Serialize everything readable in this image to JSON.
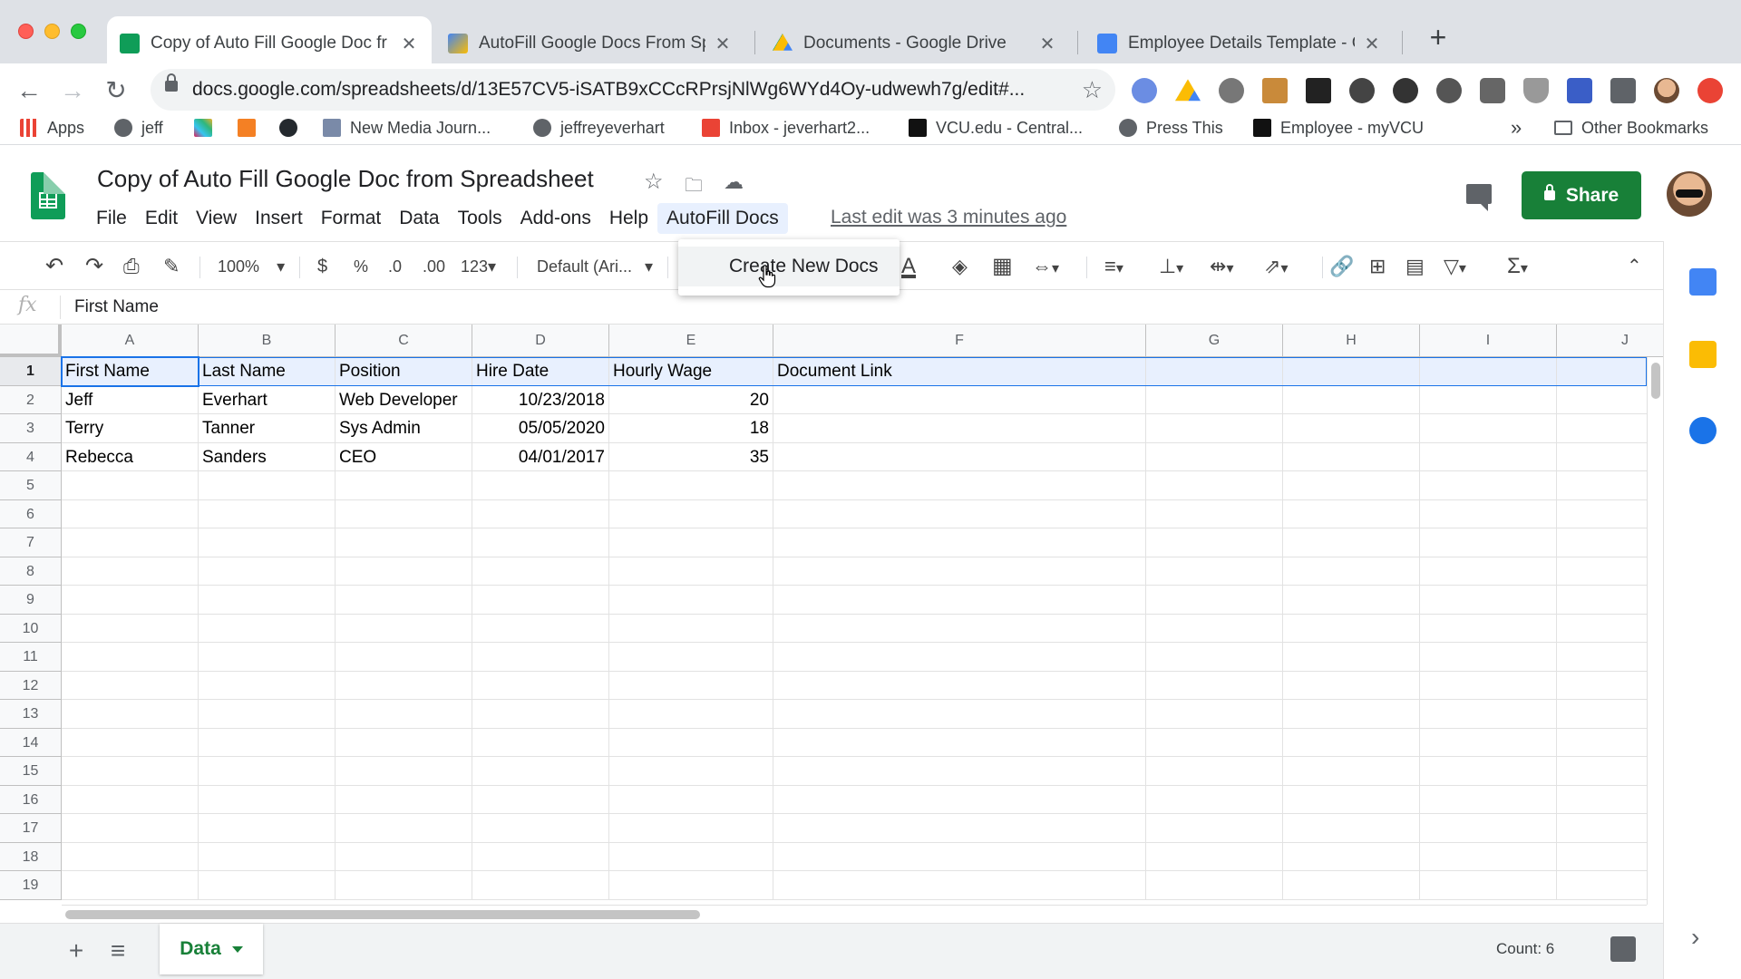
{
  "browser": {
    "tabs": [
      {
        "title": "Copy of Auto Fill Google Doc fr",
        "close": "✕",
        "favicon_color": "#0f9d58"
      },
      {
        "title": "AutoFill Google Docs From Spr",
        "close": "✕",
        "favicon_color": "#4285f4"
      },
      {
        "title": "Documents - Google Drive",
        "close": "✕",
        "favicon_color": "#fbbc04"
      },
      {
        "title": "Employee Details Template - G",
        "close": "✕",
        "favicon_color": "#4285f4"
      }
    ],
    "new_tab": "+",
    "url": "docs.google.com/spreadsheets/d/13E57CV5-iSATB9xCCcRPrsjNlWg6WYd4Oy-udwewh7g/edit#...",
    "bookmarks": [
      "Apps",
      "jeff",
      "New Media Journ...",
      "jeffreyeverhart",
      "Inbox - jeverhart2...",
      "VCU.edu - Central...",
      "Press This",
      "Employee - myVCU"
    ],
    "more_bookmarks": "»",
    "other_bookmarks": "Other Bookmarks"
  },
  "sheets": {
    "title": "Copy of Auto Fill Google Doc from Spreadsheet",
    "menu": [
      "File",
      "Edit",
      "View",
      "Insert",
      "Format",
      "Data",
      "Tools",
      "Add-ons",
      "Help",
      "AutoFill Docs"
    ],
    "last_edit": "Last edit was 3 minutes ago",
    "share_label": "Share",
    "accent_color": "#188038"
  },
  "toolbar": {
    "zoom": "100%",
    "currency": "$",
    "percent": "%",
    "decrease_decimal": ".0",
    "increase_decimal": ".00",
    "more_formats": "123",
    "font": "Default (Ari...",
    "text_color_letter": "A"
  },
  "dropdown": {
    "item": "Create New Docs"
  },
  "formula_bar": {
    "fx": "fx",
    "value": "First Name"
  },
  "grid": {
    "columns": [
      "A",
      "B",
      "C",
      "D",
      "E",
      "F",
      "G",
      "H",
      "I",
      "J"
    ],
    "rows": [
      "1",
      "2",
      "3",
      "4",
      "5",
      "6",
      "7",
      "8",
      "9",
      "10",
      "11",
      "12",
      "13",
      "14",
      "15",
      "16",
      "17",
      "18",
      "19"
    ],
    "headers": [
      "First Name",
      "Last Name",
      "Position",
      "Hire Date",
      "Hourly Wage",
      "Document Link"
    ],
    "data": [
      [
        "Jeff",
        "Everhart",
        "Web Developer",
        "10/23/2018",
        "20",
        ""
      ],
      [
        "Terry",
        "Tanner",
        "Sys Admin",
        "05/05/2020",
        "18",
        ""
      ],
      [
        "Rebecca",
        "Sanders",
        "CEO",
        "04/01/2017",
        "35",
        ""
      ]
    ]
  },
  "sheet_tabs": {
    "add": "+",
    "all_sheets": "≡",
    "active_sheet": "Data",
    "count": "Count: 6"
  }
}
